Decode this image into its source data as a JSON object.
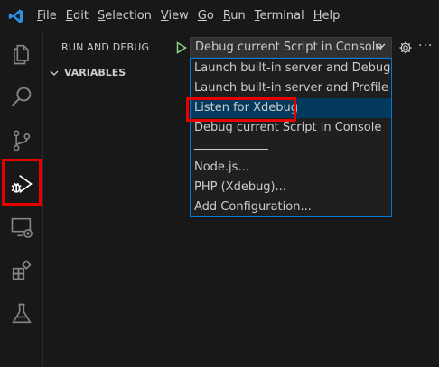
{
  "menubar": {
    "items": [
      "File",
      "Edit",
      "Selection",
      "View",
      "Go",
      "Run",
      "Terminal",
      "Help"
    ]
  },
  "activitybar": {
    "icons": [
      "files-icon",
      "search-icon",
      "source-control-icon",
      "run-debug-icon",
      "remote-explorer-icon",
      "extensions-icon",
      "testing-icon"
    ],
    "highlight_color": "#e60000"
  },
  "panel": {
    "title": "RUN AND DEBUG",
    "selected_config": "Debug current Script in Console",
    "section": "VARIABLES"
  },
  "dropdown": {
    "items": [
      "Launch built-in server and Debug",
      "Launch built-in server and Profile",
      "Listen for Xdebug",
      "Debug current Script in Console",
      "Node.js...",
      "PHP (Xdebug)...",
      "Add Configuration..."
    ],
    "selected_index": 2,
    "focus_border": "#0078d4",
    "selected_bg": "#04395e"
  }
}
